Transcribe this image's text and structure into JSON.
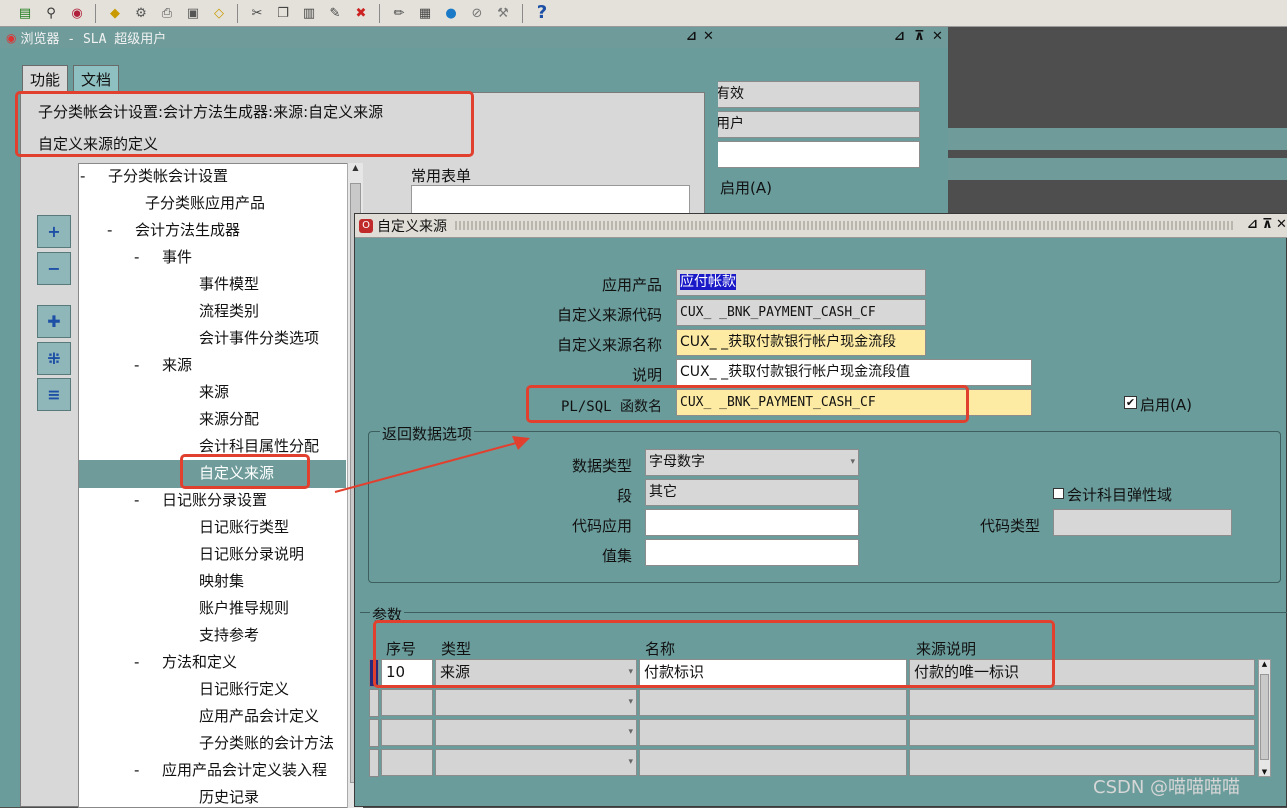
{
  "toolbar": {
    "icons": [
      "new-icon",
      "find-icon",
      "navigator-icon",
      "save-icon",
      "next-step-icon",
      "print-icon",
      "close-form-icon",
      "attachments-icon",
      "cut-icon",
      "copy-icon",
      "paste-icon",
      "clear-record-icon",
      "delete-icon",
      "edit-field-icon",
      "zoom-icon",
      "translation-icon",
      "folder-tools-icon",
      "window-help-icon",
      "help-icon"
    ],
    "help_glyph": "?"
  },
  "navigator": {
    "title": "浏览器 - SLA 超级用户",
    "tabs": [
      "功能",
      "文档"
    ],
    "breadcrumb": "子分类帐会计设置:会计方法生成器:来源:自定义来源",
    "subtitle": "自定义来源的定义",
    "tree": [
      {
        "label": "子分类帐会计设置",
        "marker": "-"
      },
      {
        "label": "子分类账应用产品",
        "marker": ""
      },
      {
        "label": "会计方法生成器",
        "marker": "-"
      },
      {
        "label": "事件",
        "marker": "-"
      },
      {
        "label": "事件模型",
        "marker": ""
      },
      {
        "label": "流程类别",
        "marker": ""
      },
      {
        "label": "会计事件分类选项",
        "marker": ""
      },
      {
        "label": "来源",
        "marker": "-"
      },
      {
        "label": "来源",
        "marker": ""
      },
      {
        "label": "来源分配",
        "marker": ""
      },
      {
        "label": "会计科目属性分配",
        "marker": ""
      },
      {
        "label": "自定义来源",
        "marker": ""
      },
      {
        "label": "日记账分录设置",
        "marker": "-"
      },
      {
        "label": "日记账行类型",
        "marker": ""
      },
      {
        "label": "日记账分录说明",
        "marker": ""
      },
      {
        "label": "映射集",
        "marker": ""
      },
      {
        "label": "账户推导规则",
        "marker": ""
      },
      {
        "label": "支持参考",
        "marker": ""
      },
      {
        "label": "方法和定义",
        "marker": "-"
      },
      {
        "label": "日记账行定义",
        "marker": ""
      },
      {
        "label": "应用产品会计定义",
        "marker": ""
      },
      {
        "label": "子分类账的会计方法",
        "marker": ""
      },
      {
        "label": "应用产品会计定义装入程",
        "marker": "-"
      },
      {
        "label": "历史记录",
        "marker": ""
      }
    ],
    "side_buttons": [
      "+",
      "−",
      "expand-branch-icon",
      "expand-all-icon",
      "collapse-all-icon"
    ],
    "top_ten_label": "常用表单"
  },
  "bg_window": {
    "field1": "有效",
    "field2": "用户",
    "enabled_label": "启用(A)"
  },
  "form": {
    "title": "自定义来源",
    "labels": {
      "app": "应用产品",
      "code": "自定义来源代码",
      "name": "自定义来源名称",
      "desc": "说明",
      "plsql": "PL/SQL 函数名",
      "enabled": "启用(A)"
    },
    "values": {
      "app": "应付帐款",
      "code": "CUX_ _BNK_PAYMENT_CASH_CF",
      "name": "CUX_ _获取付款银行帐户现金流段",
      "desc": "CUX_ _获取付款银行帐户现金流段值",
      "plsql": "CUX_ _BNK_PAYMENT_CASH_CF"
    },
    "enabled_checked": true,
    "return_section": {
      "title": "返回数据选项",
      "datatype_label": "数据类型",
      "datatype_value": "字母数字",
      "segment_label": "段",
      "segment_value": "其它",
      "code_app_label": "代码应用",
      "code_app_value": "",
      "value_set_label": "值集",
      "value_set_value": "",
      "flex_label": "会计科目弹性域",
      "code_type_label": "代码类型",
      "code_type_value": ""
    },
    "params": {
      "title": "参数",
      "headers": [
        "序号",
        "类型",
        "名称",
        "来源说明"
      ],
      "rows": [
        [
          "10",
          "来源",
          "付款标识",
          "付款的唯一标识"
        ],
        [
          "",
          "",
          "",
          ""
        ],
        [
          "",
          "",
          "",
          ""
        ],
        [
          "",
          "",
          "",
          ""
        ]
      ]
    }
  },
  "watermark": "CSDN @喵喵喵喵",
  "colors": {
    "annotation_red": "#e2402f",
    "title_teal": "#6f9c9b",
    "required_yellow": "#fdeaa3"
  }
}
